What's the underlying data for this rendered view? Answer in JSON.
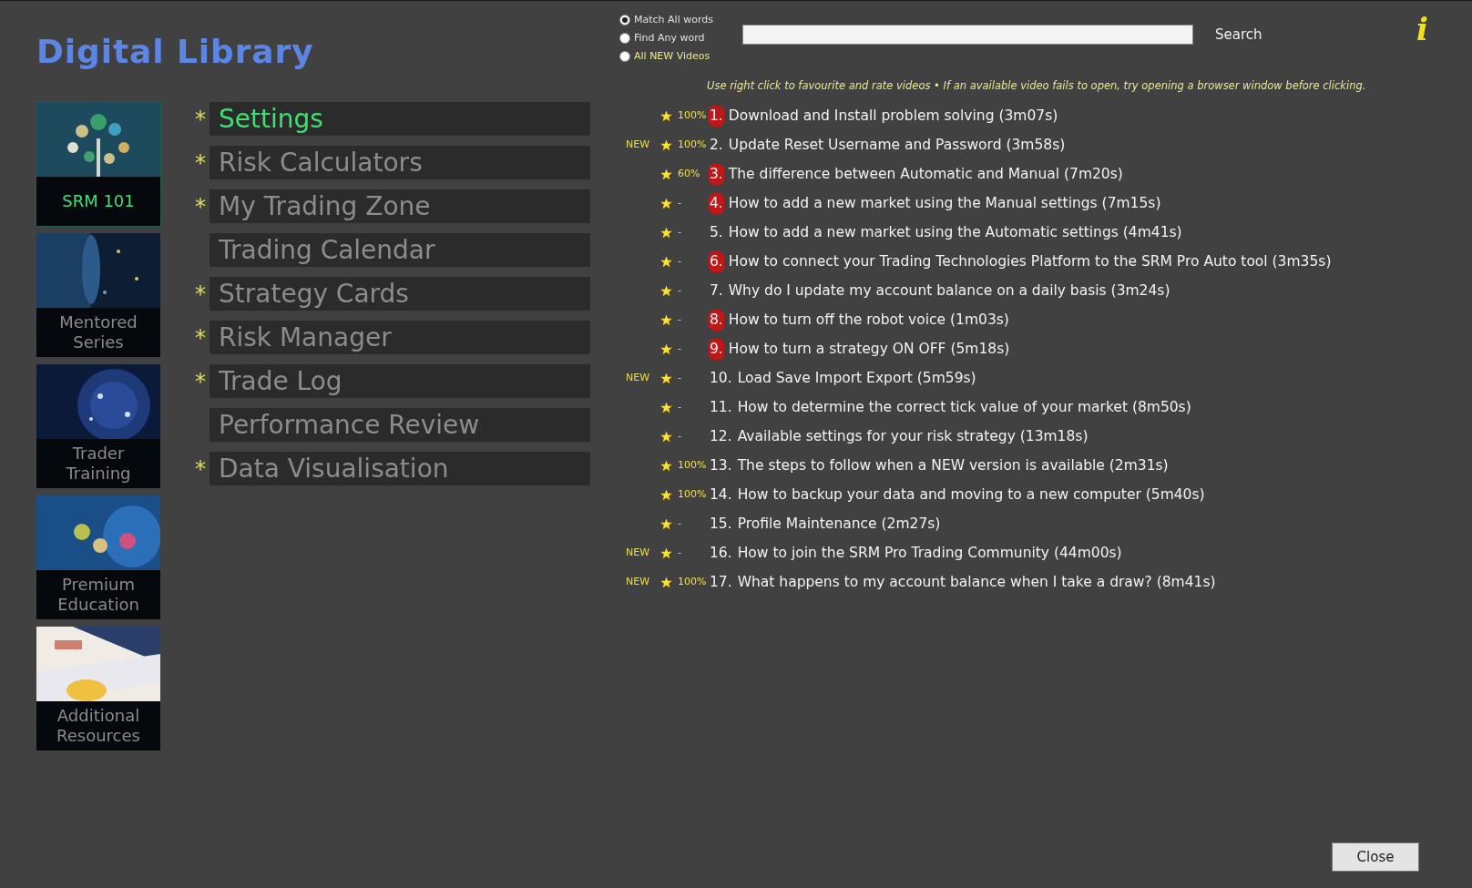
{
  "title": "Digital Library",
  "tiles": [
    {
      "label": "SRM 101",
      "selected": true
    },
    {
      "label": "Mentored Series",
      "selected": false
    },
    {
      "label": "Trader Training",
      "selected": false
    },
    {
      "label": "Premium Education",
      "selected": false
    },
    {
      "label": "Additional Resources",
      "selected": false
    }
  ],
  "menu": [
    {
      "mark": "*",
      "label": "Settings",
      "selected": true
    },
    {
      "mark": "*",
      "label": "Risk Calculators",
      "selected": false
    },
    {
      "mark": "*",
      "label": "My Trading Zone",
      "selected": false
    },
    {
      "label": "Trading Calendar",
      "selected": false
    },
    {
      "mark": "*",
      "label": "Strategy Cards",
      "selected": false
    },
    {
      "mark": "*",
      "label": "Risk Manager",
      "selected": false
    },
    {
      "mark": "*",
      "label": "Trade Log",
      "selected": false
    },
    {
      "label": "Performance Review",
      "selected": false
    },
    {
      "mark": "*",
      "label": "Data Visualisation",
      "selected": false
    }
  ],
  "search_modes": [
    {
      "label": "Match All words",
      "selected": true,
      "kind": "match"
    },
    {
      "label": "Find Any word",
      "selected": false,
      "kind": "match"
    },
    {
      "label": "All NEW Videos",
      "selected": false,
      "kind": "new"
    }
  ],
  "search_button": "Search",
  "info_icon": "i",
  "hint": "Use right click to favourite and rate videos • If an available video fails to open, try opening a browser window before clicking.",
  "videos": [
    {
      "rating": "100%",
      "favourite": true,
      "number": "1.",
      "title": "Download and Install problem solving (3m07s)"
    },
    {
      "badge": "NEW",
      "rating": "100%",
      "favourite": false,
      "number": "2.",
      "title": "Update Reset Username and Password (3m58s)"
    },
    {
      "rating": "60%",
      "favourite": true,
      "number": "3.",
      "title": "The difference between Automatic and Manual (7m20s)"
    },
    {
      "rating": "-",
      "favourite": true,
      "number": "4.",
      "title": "How to add a new market using the Manual settings (7m15s)"
    },
    {
      "rating": "-",
      "favourite": false,
      "number": "5.",
      "title": "How to add a new market using the Automatic settings (4m41s)"
    },
    {
      "rating": "-",
      "favourite": true,
      "number": "6.",
      "title": "How to connect your Trading Technologies Platform to the SRM Pro Auto tool (3m35s)"
    },
    {
      "rating": "-",
      "favourite": false,
      "number": "7.",
      "title": "Why do I update my account balance on a daily basis (3m24s)"
    },
    {
      "rating": "-",
      "favourite": true,
      "number": "8.",
      "title": "How to turn off the robot voice (1m03s)"
    },
    {
      "rating": "-",
      "favourite": true,
      "number": "9.",
      "title": "How to turn a strategy ON OFF (5m18s)"
    },
    {
      "badge": "NEW",
      "rating": "-",
      "favourite": false,
      "number": "10.",
      "title": "Load Save Import Export (5m59s)"
    },
    {
      "rating": "-",
      "favourite": false,
      "number": "11.",
      "title": "How to determine the correct tick value of your market (8m50s)"
    },
    {
      "rating": "-",
      "favourite": false,
      "number": "12.",
      "title": "Available settings for your risk strategy (13m18s)"
    },
    {
      "rating": "100%",
      "favourite": false,
      "number": "13.",
      "title": "The steps to follow when a NEW version is available (2m31s)"
    },
    {
      "rating": "100%",
      "favourite": false,
      "number": "14.",
      "title": "How to backup your data and moving to a new computer (5m40s)"
    },
    {
      "rating": "-",
      "favourite": false,
      "number": "15.",
      "title": "Profile Maintenance (2m27s)"
    },
    {
      "badge": "NEW",
      "rating": "-",
      "favourite": false,
      "number": "16.",
      "title": "How to join the SRM Pro Trading Community (44m00s)"
    },
    {
      "badge": "NEW",
      "rating": "100%",
      "favourite": false,
      "number": "17.",
      "title": "What happens to my account balance when I take a draw? (8m41s)"
    }
  ],
  "close_button": "Close"
}
